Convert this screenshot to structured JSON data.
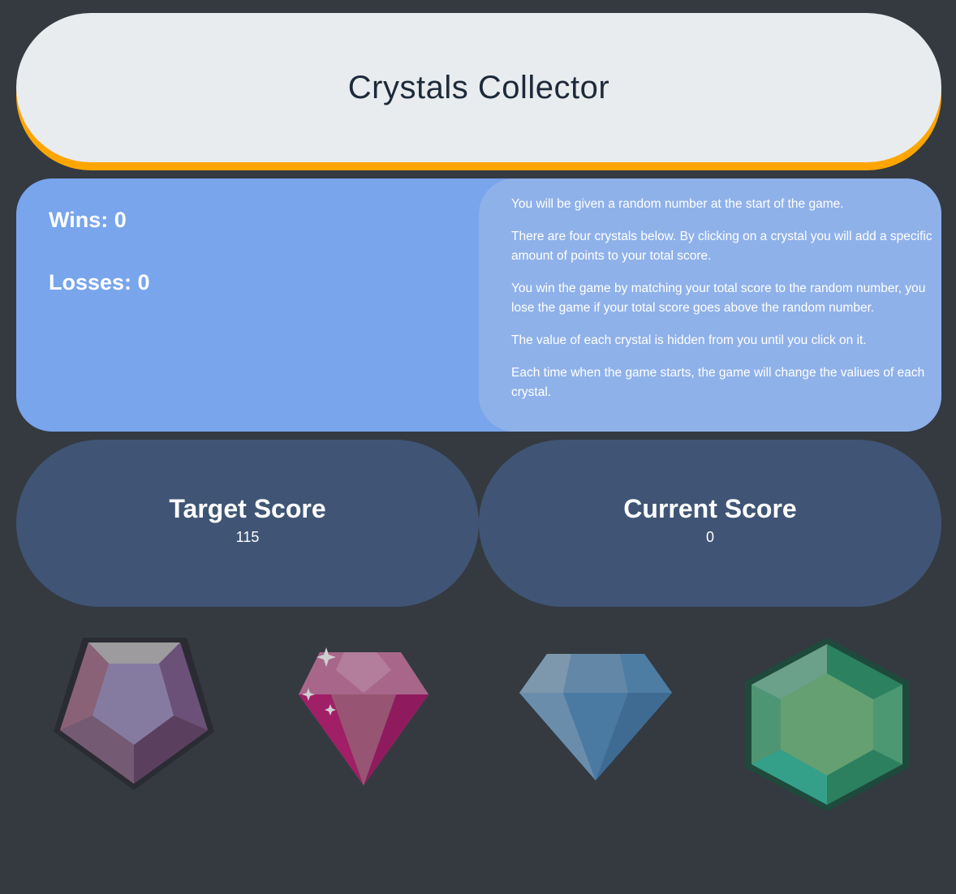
{
  "header": {
    "title": "Crystals Collector"
  },
  "stats": {
    "wins_label": "Wins: 0",
    "losses_label": "Losses: 0"
  },
  "instructions": [
    "You will be given a random number at the start of the game.",
    "There are four crystals below. By clicking on a crystal you will add a specific amount of points to your total score.",
    "You win the game by matching your total score to the random number, you lose the game if your total score goes above the random number.",
    "The value of each crystal is hidden from you until you click on it.",
    "Each time when the game starts, the game will change the valiues of each crystal."
  ],
  "target": {
    "label": "Target Score",
    "value": "115"
  },
  "current": {
    "label": "Current Score",
    "value": "0"
  },
  "crystals": [
    {
      "icon": "pentagon-crystal-icon",
      "color": "#8a7bb0"
    },
    {
      "icon": "ruby-crystal-icon",
      "color": "#a0457a"
    },
    {
      "icon": "diamond-crystal-icon",
      "color": "#4b77a0"
    },
    {
      "icon": "emerald-crystal-icon",
      "color": "#2f8a62"
    }
  ],
  "colors": {
    "background": "#343a40",
    "header": "#e9ecef",
    "header_accent": "#ffa500",
    "info": "#78a5ec",
    "instructions": "#8fb1ea",
    "score_box": "#405575"
  }
}
